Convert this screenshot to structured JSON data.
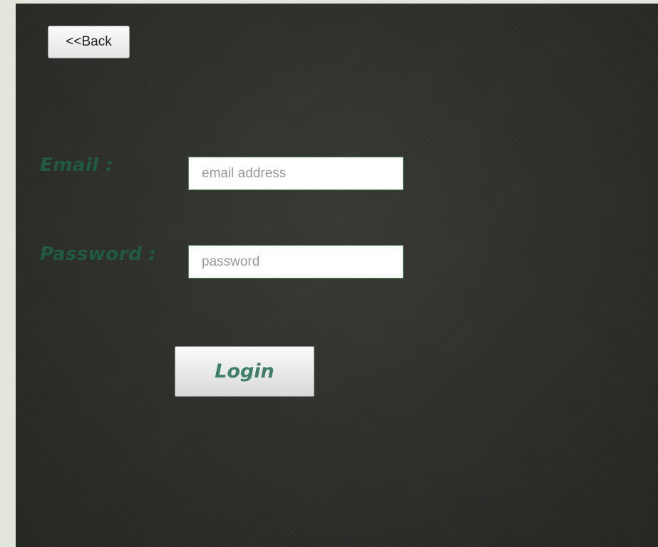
{
  "nav": {
    "back_label": "<<Back"
  },
  "form": {
    "email_label": "Email :",
    "email_placeholder": "email address",
    "email_value": "",
    "password_label": "Password :",
    "password_placeholder": "password",
    "password_value": "",
    "login_label": "Login"
  },
  "colors": {
    "label_text": "#1f5a41",
    "login_text": "#3f7f6a",
    "background": "#2f302c",
    "frame": "#e3e6dc"
  }
}
